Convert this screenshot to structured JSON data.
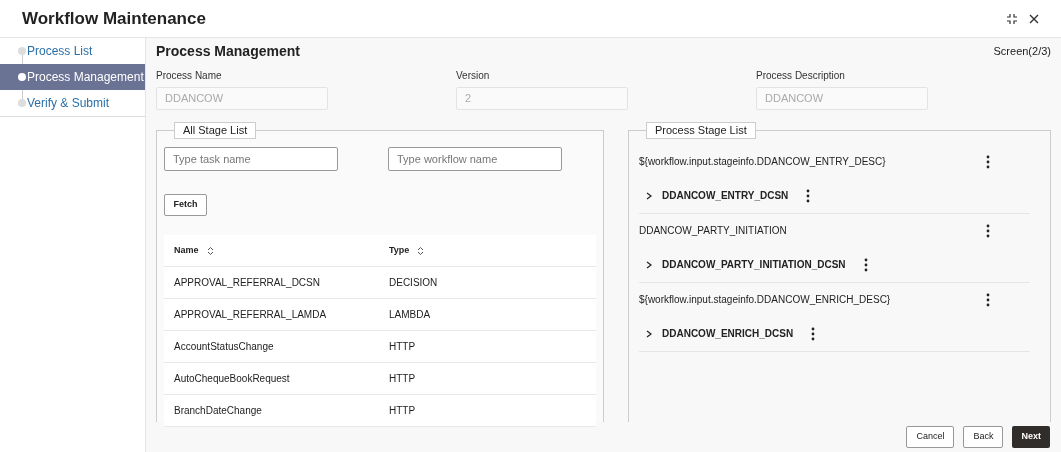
{
  "window": {
    "title": "Workflow Maintenance"
  },
  "steps": [
    {
      "label": "Process List",
      "selected": false
    },
    {
      "label": "Process Management",
      "selected": true
    },
    {
      "label": "Verify & Submit",
      "selected": false
    }
  ],
  "section": {
    "title": "Process Management",
    "screen": "Screen(2/3)"
  },
  "fields": [
    {
      "label": "Process Name",
      "value": "DDANCOW"
    },
    {
      "label": "Version",
      "value": "2"
    },
    {
      "label": "Process Description",
      "value": "DDANCOW"
    }
  ],
  "all_stage_list": {
    "legend": "All Stage List",
    "task_search": {
      "placeholder": "Type task name"
    },
    "workflow_search": {
      "placeholder": "Type workflow name"
    },
    "fetch": "Fetch",
    "columns": [
      "Name",
      "Type"
    ],
    "rows": [
      [
        "APPROVAL_REFERRAL_DCSN",
        "DECISION"
      ],
      [
        "APPROVAL_REFERRAL_LAMDA",
        "LAMBDA"
      ],
      [
        "AccountStatusChange",
        "HTTP"
      ],
      [
        "AutoChequeBookRequest",
        "HTTP"
      ],
      [
        "BranchDateChange",
        "HTTP"
      ]
    ]
  },
  "process_stage_list": {
    "legend": "Process Stage List",
    "items": [
      {
        "kind": "stage",
        "label": "${workflow.input.stageinfo.DDANCOW_ENTRY_DESC}"
      },
      {
        "kind": "decision",
        "label": "DDANCOW_ENTRY_DCSN",
        "expanded": false
      },
      {
        "kind": "stage",
        "label": "DDANCOW_PARTY_INITIATION"
      },
      {
        "kind": "decision",
        "label": "DDANCOW_PARTY_INITIATION_DCSN",
        "expanded": false
      },
      {
        "kind": "stage",
        "label": "${workflow.input.stageinfo.DDANCOW_ENRICH_DESC}"
      },
      {
        "kind": "decision",
        "label": "DDANCOW_ENRICH_DCSN",
        "expanded": false
      }
    ]
  },
  "buttons": [
    {
      "label": "Cancel",
      "kind": "secondary"
    },
    {
      "label": "Back",
      "kind": "secondary"
    },
    {
      "label": "Next",
      "kind": "primary"
    }
  ]
}
